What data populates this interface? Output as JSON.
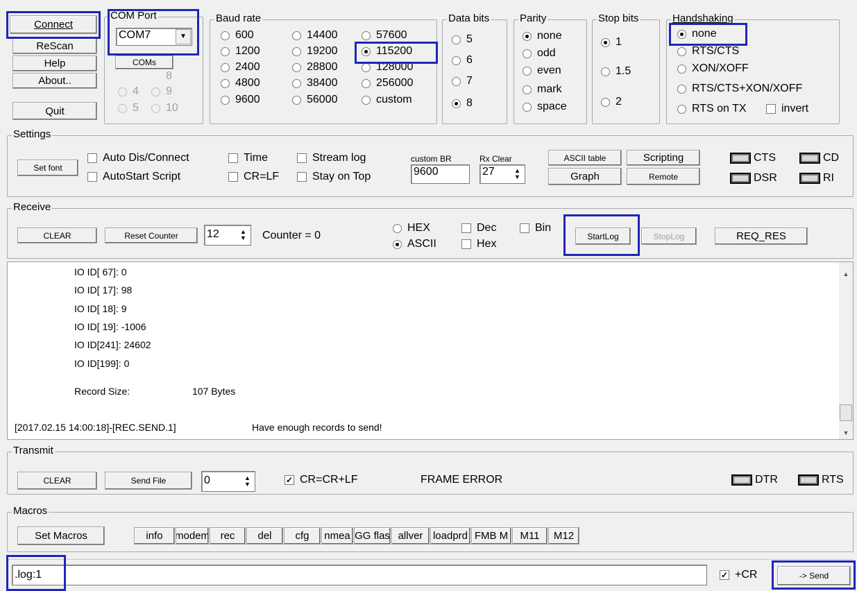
{
  "buttons": {
    "connect": "Connect",
    "rescan": "ReScan",
    "help": "Help",
    "about": "About..",
    "quit": "Quit",
    "coms": "COMs"
  },
  "com_port": {
    "legend": "COM Port",
    "value": "COM7",
    "hidden_options": [
      "8",
      "4",
      "9",
      "5",
      "10"
    ]
  },
  "baud_rate": {
    "legend": "Baud rate",
    "options": [
      "600",
      "14400",
      "57600",
      "1200",
      "19200",
      "115200",
      "2400",
      "28800",
      "128000",
      "4800",
      "38400",
      "256000",
      "9600",
      "56000",
      "custom"
    ],
    "selected": "115200"
  },
  "data_bits": {
    "legend": "Data bits",
    "options": [
      "5",
      "6",
      "7",
      "8"
    ],
    "selected": "8"
  },
  "parity": {
    "legend": "Parity",
    "options": [
      "none",
      "odd",
      "even",
      "mark",
      "space"
    ],
    "selected": "none"
  },
  "stop_bits": {
    "legend": "Stop bits",
    "options": [
      "1",
      "1.5",
      "2"
    ],
    "selected": "1"
  },
  "handshaking": {
    "legend": "Handshaking",
    "options": [
      "none",
      "RTS/CTS",
      "XON/XOFF",
      "RTS/CTS+XON/XOFF",
      "RTS on TX"
    ],
    "selected": "none",
    "invert_label": "invert"
  },
  "settings": {
    "legend": "Settings",
    "set_font": "Set font",
    "auto_dis_connect": "Auto Dis/Connect",
    "autostart_script": "AutoStart Script",
    "time": "Time",
    "cr_lf": "CR=LF",
    "stream_log": "Stream log",
    "stay_on_top": "Stay on Top",
    "custom_br_label": "custom BR",
    "custom_br_value": "9600",
    "rx_clear_label": "Rx Clear",
    "rx_clear_value": "27",
    "ascii_table": "ASCII table",
    "scripting": "Scripting",
    "graph": "Graph",
    "remote": "Remote",
    "leds": [
      "CTS",
      "CD",
      "DSR",
      "RI"
    ]
  },
  "receive": {
    "legend": "Receive",
    "clear": "CLEAR",
    "reset_counter": "Reset Counter",
    "counter_spin": "12",
    "counter_text": "Counter = 0",
    "hex": "HEX",
    "ascii": "ASCII",
    "dec": "Dec",
    "bin": "Bin",
    "hex2": "Hex",
    "start_log": "StartLog",
    "stop_log": "StopLog",
    "req_res": "REQ_RES"
  },
  "terminal": {
    "lines": [
      "IO ID[ 67]: 0",
      "IO ID[ 17]: 98",
      "IO ID[ 18]: 9",
      "IO ID[ 19]: -1006",
      "IO ID[241]: 24602",
      "IO ID[199]: 0"
    ],
    "record_label": "Record Size:",
    "record_value": "107 Bytes",
    "last_line_time": "[2017.02.15 14:00:18]-[REC.SEND.1]",
    "last_line_msg": "Have enough records to send!"
  },
  "transmit": {
    "legend": "Transmit",
    "clear": "CLEAR",
    "send_file": "Send File",
    "spin_value": "0",
    "cr_crlf": "CR=CR+LF",
    "frame_error": "FRAME ERROR",
    "leds": [
      "DTR",
      "RTS"
    ]
  },
  "macros": {
    "legend": "Macros",
    "set_macros": "Set Macros",
    "items": [
      "info",
      "modem",
      "rec",
      "del",
      "cfg",
      "nmea",
      "GG flas",
      "allver",
      "loadprd",
      "FMB M",
      "M11",
      "M12"
    ]
  },
  "send_bar": {
    "input_value": ".log:1",
    "plus_cr": "+CR",
    "send": "-> Send"
  }
}
